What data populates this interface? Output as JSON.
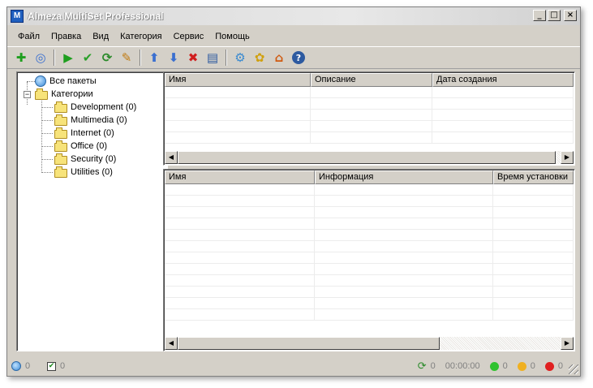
{
  "window": {
    "title": "Almeza MultiSet Professional",
    "icon_letter": "M"
  },
  "title_buttons": {
    "minimize": "_",
    "maximize": "□",
    "close": "×"
  },
  "menu": [
    "Файл",
    "Правка",
    "Вид",
    "Категория",
    "Сервис",
    "Помощь"
  ],
  "toolbar": [
    {
      "name": "add-icon",
      "glyph": "✚",
      "color": "#1e9e1e"
    },
    {
      "name": "disc-icon",
      "glyph": "◎",
      "color": "#3a6fd0"
    },
    {
      "name": "play-icon",
      "glyph": "▶",
      "color": "#1e9e1e"
    },
    {
      "name": "check-icon",
      "glyph": "✔",
      "color": "#2aa02a"
    },
    {
      "name": "refresh-icon",
      "glyph": "⟳",
      "color": "#2a8a2a"
    },
    {
      "name": "brush-icon",
      "glyph": "✎",
      "color": "#c07a10"
    },
    {
      "name": "arrow-up-icon",
      "glyph": "⬆",
      "color": "#3a6fd0"
    },
    {
      "name": "arrow-down-icon",
      "glyph": "⬇",
      "color": "#3a6fd0"
    },
    {
      "name": "delete-icon",
      "glyph": "✖",
      "color": "#d01e1e"
    },
    {
      "name": "properties-icon",
      "glyph": "▤",
      "color": "#2d5aa0"
    },
    {
      "name": "network-icon",
      "glyph": "⚙",
      "color": "#3a8ad0"
    },
    {
      "name": "settings-icon",
      "glyph": "✿",
      "color": "#d0a010"
    },
    {
      "name": "home-icon",
      "glyph": "⌂",
      "color": "#d05a10"
    },
    {
      "name": "help-icon",
      "glyph": "?",
      "color": "#2d5aa0"
    }
  ],
  "tree": {
    "all_packages": "Все пакеты",
    "categories": "Категории",
    "items": [
      "Development (0)",
      "Multimedia (0)",
      "Internet (0)",
      "Office (0)",
      "Security (0)",
      "Utilities (0)"
    ]
  },
  "top_table": {
    "columns": [
      "Имя",
      "Описание",
      "Дата создания"
    ]
  },
  "bottom_table": {
    "columns": [
      "Имя",
      "Информация",
      "Время установки"
    ]
  },
  "status": {
    "packages_count": "0",
    "checked_count": "0",
    "running_count": "0",
    "time": "00:00:00",
    "green_count": "0",
    "yellow_count": "0",
    "red_count": "0",
    "colors": {
      "green": "#2fc22f",
      "yellow": "#f0b020",
      "red": "#e02020"
    }
  }
}
